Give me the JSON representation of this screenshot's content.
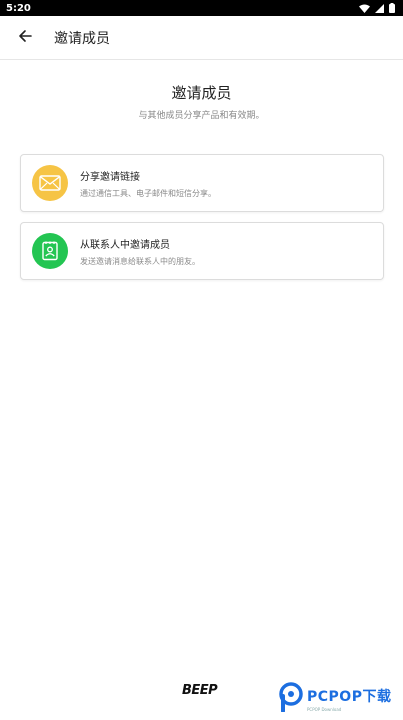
{
  "status_bar": {
    "time": "5:20"
  },
  "app_bar": {
    "title": "邀请成员"
  },
  "main": {
    "heading": "邀请成员",
    "subheading": "与其他成员分享产品和有效期。"
  },
  "options": [
    {
      "title": "分享邀请链接",
      "description": "通过通信工具、电子邮件和短信分享。",
      "icon": "mail-icon",
      "color": "#F6C445"
    },
    {
      "title": "从联系人中邀请成员",
      "description": "发送邀请消息给联系人中的朋友。",
      "icon": "contact-book-icon",
      "color": "#23C552"
    }
  ],
  "footer": {
    "logo_text": "BEEP",
    "watermark": "PCPOP下载",
    "watermark_sub": "PCPOP Download"
  }
}
